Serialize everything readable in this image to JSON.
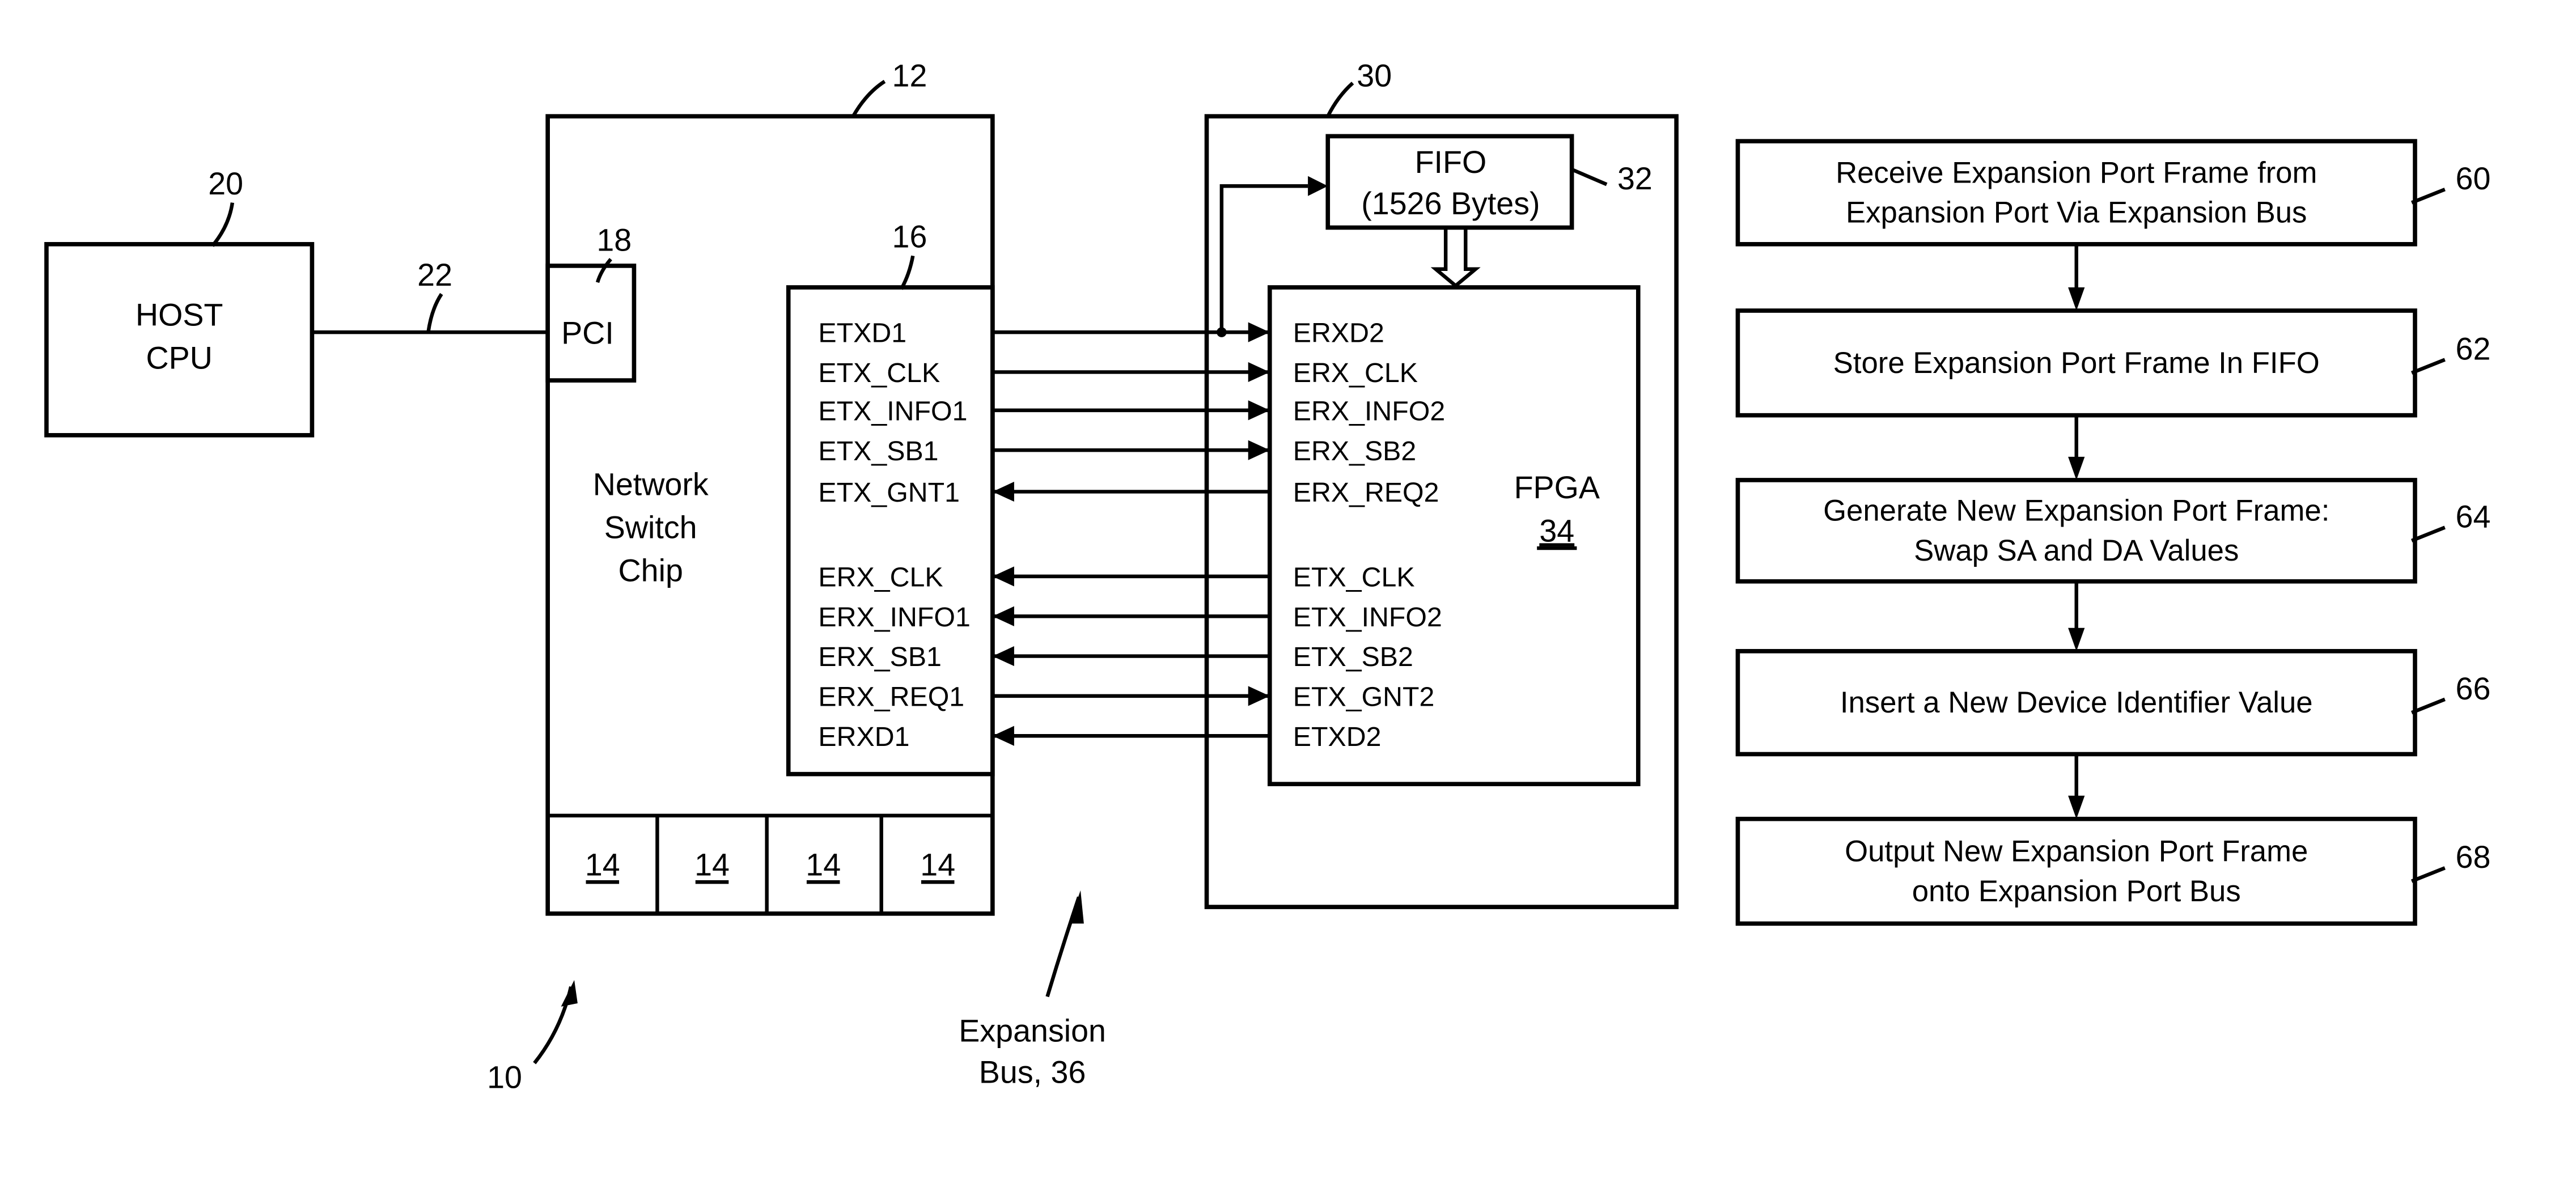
{
  "host": {
    "label_line1": "HOST",
    "label_line2": "CPU",
    "ref": "20"
  },
  "host_link": {
    "ref": "22"
  },
  "switch_chip": {
    "ref": "12",
    "label_line1": "Network",
    "label_line2": "Switch",
    "label_line3": "Chip",
    "pci": {
      "label": "PCI",
      "ref": "18"
    },
    "port_interface": {
      "ref": "16"
    },
    "ports": [
      "14",
      "14",
      "14",
      "14"
    ]
  },
  "expansion_device": {
    "ref": "30",
    "fifo": {
      "label_line1": "FIFO",
      "label_line2": "(1526 Bytes)",
      "ref": "32"
    },
    "fpga": {
      "label": "FPGA",
      "ref": "34"
    }
  },
  "signals": [
    {
      "left": "ETXD1",
      "right": "ERXD2",
      "direction": "right"
    },
    {
      "left": "ETX_CLK",
      "right": "ERX_CLK",
      "direction": "right"
    },
    {
      "left": "ETX_INFO1",
      "right": "ERX_INFO2",
      "direction": "right"
    },
    {
      "left": "ETX_SB1",
      "right": "ERX_SB2",
      "direction": "right"
    },
    {
      "left": "ETX_GNT1",
      "right": "ERX_REQ2",
      "direction": "left"
    },
    {
      "left": "ERX_CLK",
      "right": "ETX_CLK",
      "direction": "left"
    },
    {
      "left": "ERX_INFO1",
      "right": "ETX_INFO2",
      "direction": "left"
    },
    {
      "left": "ERX_SB1",
      "right": "ETX_SB2",
      "direction": "left"
    },
    {
      "left": "ERX_REQ1",
      "right": "ETX_GNT2",
      "direction": "right"
    },
    {
      "left": "ERXD1",
      "right": "ETXD2",
      "direction": "left"
    }
  ],
  "system_ref": "10",
  "expansion_bus": {
    "label_line1": "Expansion",
    "label_line2": "Bus, 36"
  },
  "flowchart": [
    {
      "ref": "60",
      "lines": [
        "Receive Expansion Port Frame from",
        "Expansion Port Via Expansion Bus"
      ]
    },
    {
      "ref": "62",
      "lines": [
        "Store Expansion Port Frame In FIFO"
      ]
    },
    {
      "ref": "64",
      "lines": [
        "Generate New Expansion Port Frame:",
        "Swap SA and DA Values"
      ]
    },
    {
      "ref": "66",
      "lines": [
        "Insert a New Device Identifier Value"
      ]
    },
    {
      "ref": "68",
      "lines": [
        "Output New Expansion Port Frame",
        "onto Expansion Port Bus"
      ]
    }
  ]
}
